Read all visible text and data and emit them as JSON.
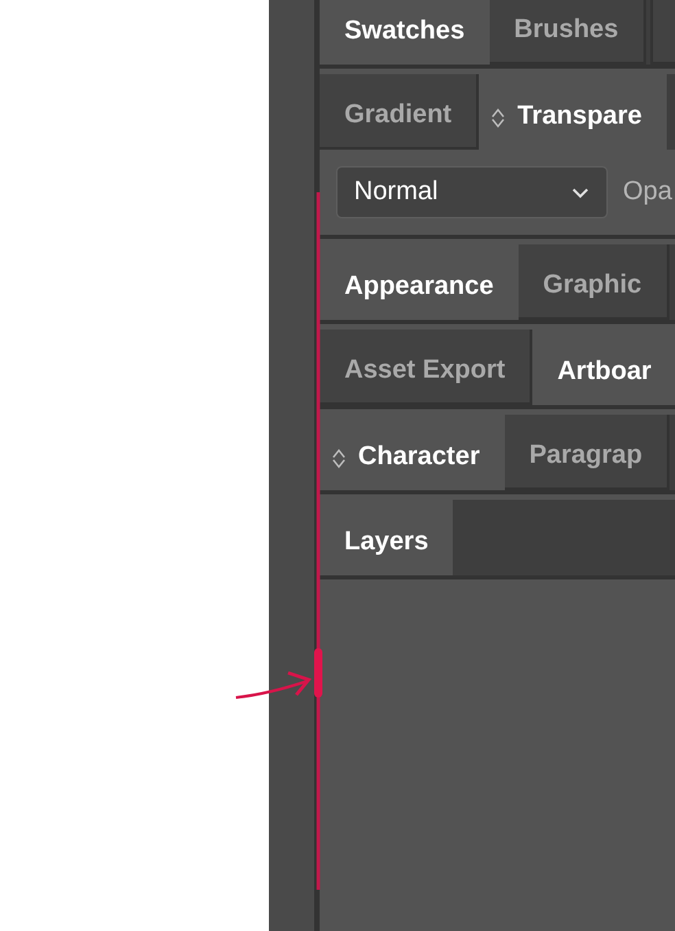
{
  "panel_groups": [
    {
      "tabs": [
        {
          "label": "Swatches",
          "selected": true,
          "collapsible": false
        },
        {
          "label": "Brushes",
          "selected": false,
          "collapsible": false
        }
      ]
    },
    {
      "tabs": [
        {
          "label": "Gradient",
          "selected": false,
          "collapsible": false
        },
        {
          "label": "Transpare",
          "selected": true,
          "collapsible": true
        }
      ],
      "content": {
        "kind": "blend",
        "blend_mode": "Normal",
        "opacity_label": "Opa"
      }
    },
    {
      "tabs": [
        {
          "label": "Appearance",
          "selected": true,
          "collapsible": false
        },
        {
          "label": "Graphic",
          "selected": false,
          "collapsible": false
        }
      ]
    },
    {
      "tabs": [
        {
          "label": "Asset Export",
          "selected": false,
          "collapsible": false
        },
        {
          "label": "Artboar",
          "selected": true,
          "collapsible": false
        }
      ]
    },
    {
      "tabs": [
        {
          "label": "Character",
          "selected": true,
          "collapsible": true
        },
        {
          "label": "Paragrap",
          "selected": false,
          "collapsible": false
        }
      ]
    },
    {
      "tabs": [
        {
          "label": "Layers",
          "selected": true,
          "collapsible": false
        }
      ]
    }
  ]
}
